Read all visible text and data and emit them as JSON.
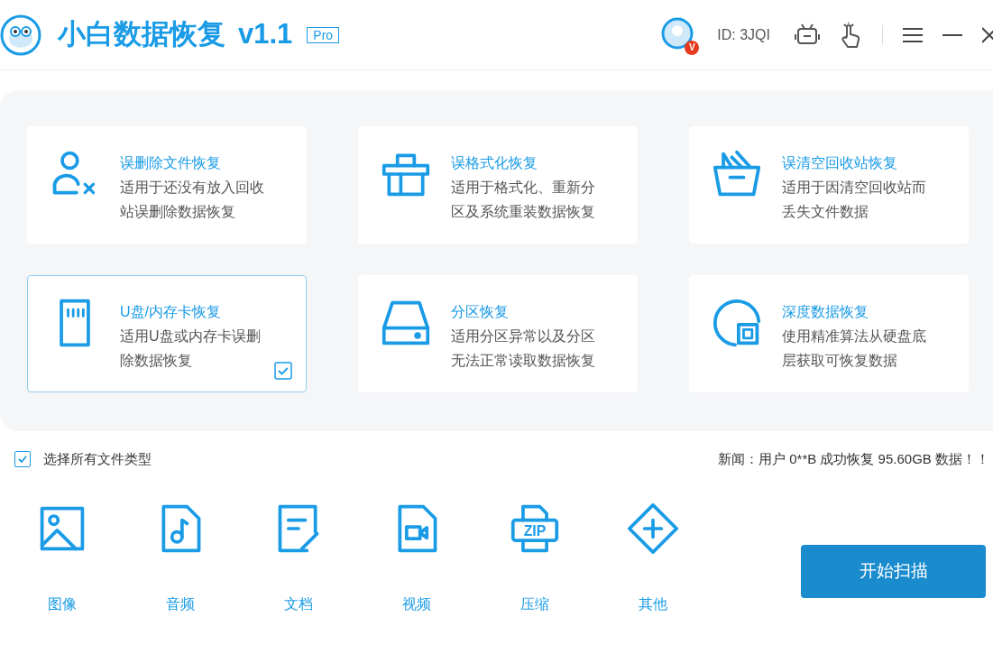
{
  "app": {
    "title": "小白数据恢复",
    "version": "v1.1",
    "edition": "Pro",
    "user_badge": "V",
    "user_id": "ID: 3JQI"
  },
  "modes": [
    {
      "kind": "deleted",
      "title": "误删除文件恢复",
      "description": "适用于还没有放入回收站误删除数据恢复",
      "selected": false
    },
    {
      "kind": "format",
      "title": "误格式化恢复",
      "description": "适用于格式化、重新分区及系统重装数据恢复",
      "selected": false
    },
    {
      "kind": "recycle",
      "title": "误清空回收站恢复",
      "description": "适用于因清空回收站而丢失文件数据",
      "selected": false
    },
    {
      "kind": "card",
      "title": "U盘/内存卡恢复",
      "description": "适用U盘或内存卡误删除数据恢复",
      "selected": true
    },
    {
      "kind": "partition",
      "title": "分区恢复",
      "description": "适用分区异常以及分区无法正常读取数据恢复",
      "selected": false
    },
    {
      "kind": "deep",
      "title": "深度数据恢复",
      "description": "使用精准算法从硬盘底层获取可恢复数据",
      "selected": false
    }
  ],
  "select_all": {
    "label": "选择所有文件类型",
    "checked": true
  },
  "news": "新闻：用户 0**B 成功恢复 95.60GB 数据！！",
  "file_types": [
    {
      "kind": "image",
      "label": "图像"
    },
    {
      "kind": "audio",
      "label": "音频"
    },
    {
      "kind": "document",
      "label": "文档"
    },
    {
      "kind": "video",
      "label": "视频"
    },
    {
      "kind": "zip",
      "label": "压缩",
      "icon_text": "ZIP"
    },
    {
      "kind": "other",
      "label": "其他"
    }
  ],
  "scan_button": "开始扫描"
}
